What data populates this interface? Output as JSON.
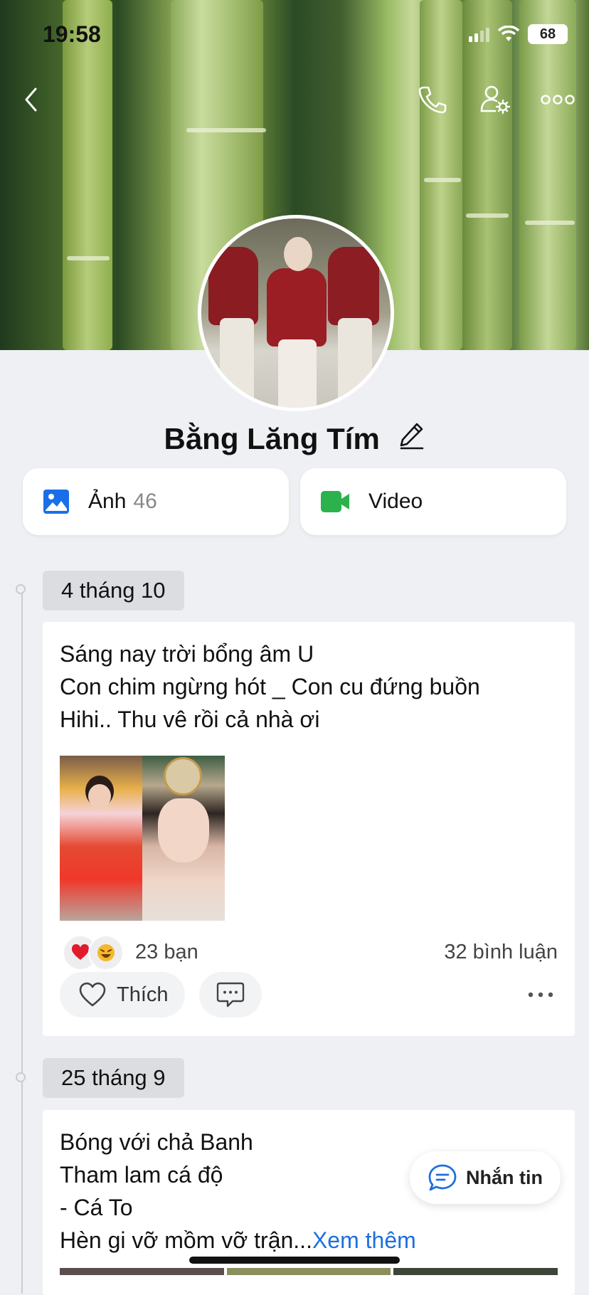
{
  "status_bar": {
    "time": "19:58",
    "battery": "68"
  },
  "header": {
    "back_icon": "chevron-left-icon",
    "call_icon": "phone-icon",
    "settings_icon": "user-settings-icon",
    "more_icon": "more-horizontal-icon"
  },
  "profile": {
    "name": "Bằng Lăng Tím"
  },
  "media": {
    "photos_label": "Ảnh",
    "photos_count": "46",
    "video_label": "Video",
    "photos_color": "#1a6fe8",
    "video_color": "#2bb24c"
  },
  "posts": [
    {
      "date": "4 tháng 10",
      "lines": [
        "Sáng nay trời bổng âm U",
        "Con chim ngừng hót _ Con cu đứng buồn",
        "Hihi.. Thu vê rồi cả nhà ơi"
      ],
      "reaction_count": "23 bạn",
      "comment_count": "32 bình luận",
      "like_label": "Thích"
    },
    {
      "date": "25 tháng 9",
      "lines": [
        "Bóng với chả Banh",
        "Tham lam cá độ",
        "- Cá To",
        "Hèn gi vỡ mồm vỡ trận..."
      ],
      "see_more": "Xem thêm"
    }
  ],
  "fab": {
    "label": "Nhắn tin"
  }
}
